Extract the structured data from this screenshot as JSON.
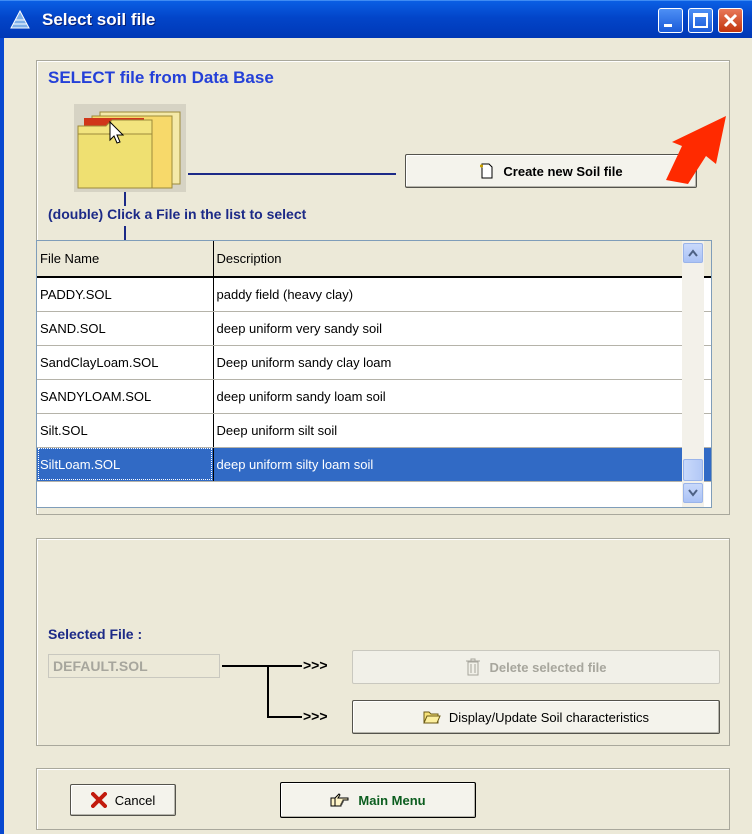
{
  "window": {
    "title": "Select soil file"
  },
  "top": {
    "heading": "SELECT file from Data Base",
    "create_label": "Create new Soil file",
    "hint": "(double) Click a File in the list to select"
  },
  "list": {
    "columns": [
      "File Name",
      "Description"
    ],
    "rows": [
      {
        "name": "PADDY.SOL",
        "description": "paddy field (heavy clay)"
      },
      {
        "name": "SAND.SOL",
        "description": "deep uniform very sandy soil"
      },
      {
        "name": "SandClayLoam.SOL",
        "description": "Deep uniform sandy clay loam"
      },
      {
        "name": "SANDYLOAM.SOL",
        "description": "deep uniform sandy loam soil"
      },
      {
        "name": "Silt.SOL",
        "description": "Deep uniform silt soil"
      },
      {
        "name": "SiltLoam.SOL",
        "description": "deep uniform silty loam soil"
      }
    ],
    "selected_index": 5
  },
  "selected": {
    "label": "Selected File :",
    "value": "DEFAULT.SOL",
    "arrows": ">>>",
    "delete_label": "Delete selected file",
    "display_label": "Display/Update Soil characteristics"
  },
  "footer": {
    "cancel_label": "Cancel",
    "main_menu_label": "Main Menu"
  },
  "colors": {
    "heading": "#2440d8",
    "selection": "#316ac5",
    "accent_arrow": "#ff2a00"
  },
  "icons": [
    "app-icon",
    "minimize-icon",
    "maximize-icon",
    "close-icon",
    "folder-stack-icon",
    "new-file-icon",
    "arrow-pointer-icon",
    "trash-icon",
    "open-folder-icon",
    "cancel-x-icon",
    "pointing-hand-icon",
    "scroll-up-icon",
    "scroll-down-icon"
  ]
}
